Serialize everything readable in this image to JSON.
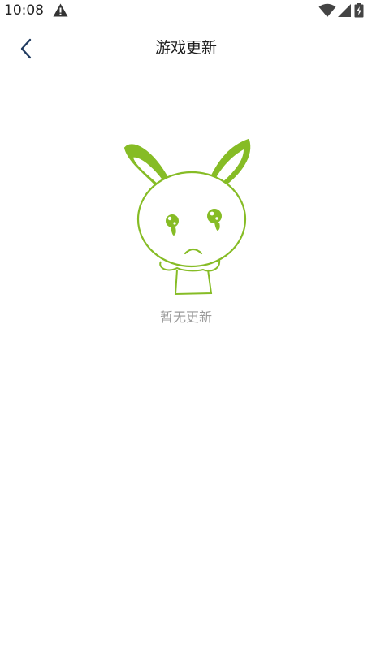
{
  "status_bar": {
    "time": "10:08",
    "icons": [
      "warning-icon",
      "wifi-icon",
      "signal-icon",
      "battery-charging-icon"
    ]
  },
  "toolbar": {
    "back_icon": "chevron-left-icon",
    "title": "游戏更新"
  },
  "empty_state": {
    "illustration": "sad-bunny-illustration",
    "message": "暂无更新"
  },
  "colors": {
    "accent": "#86bc25",
    "back_icon": "#1f3a5f",
    "text_primary": "#1e1e1e",
    "text_secondary": "#9a9a9a",
    "background": "#ffffff"
  }
}
